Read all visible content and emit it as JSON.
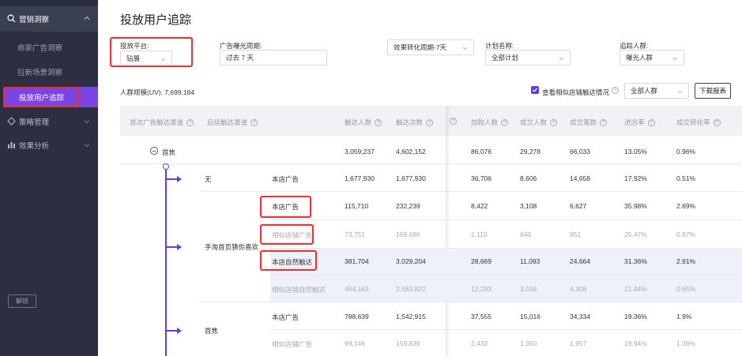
{
  "sidebar": {
    "top_item": "营销洞察",
    "sub_items": [
      "商家广告洞察",
      "拉新场景洞察"
    ],
    "active_item": "投放用户追踪",
    "groups": [
      "策略管理",
      "效果分析"
    ],
    "unlock": "解锁"
  },
  "page": {
    "title": "投放用户追踪"
  },
  "filters": {
    "platform": {
      "label": "投放平台:",
      "value": "钻展"
    },
    "period": {
      "label": "广告曝光周期:",
      "value": "过去 7 天"
    },
    "conversion": {
      "value": "效果转化周期-7天"
    },
    "plan": {
      "label": "计划名称:",
      "value": "全部计划"
    },
    "audience": {
      "label": "追踪人群:",
      "value": "曝光人群"
    }
  },
  "summary": {
    "uv": "人群规模(UV): 7,699,184",
    "similar_check_label": "查看相似店铺触达情况",
    "all_crowd": "全部人群",
    "download": "下载报表"
  },
  "table": {
    "headers": [
      "首次广告触达渠道",
      "后续触达渠道",
      "触达人数",
      "触达次数",
      "加购人数",
      "成交人数",
      "成交笔数",
      "进店率",
      "成交转化率"
    ],
    "help_mark": "?",
    "rows": [
      {
        "channel": "首焦",
        "sub": "",
        "source": "",
        "values": [
          "3,059,237",
          "4,602,152",
          "86,076",
          "29,278",
          "66,033",
          "13.05%",
          "0.96%"
        ]
      },
      {
        "channel": "",
        "sub": "无",
        "source": "本店广告",
        "values": [
          "1,677,930",
          "1,677,930",
          "36,706",
          "8,606",
          "14,658",
          "17.92%",
          "0.51%"
        ]
      },
      {
        "channel": "",
        "sub": "",
        "source": "本店广告",
        "values": [
          "115,710",
          "232,239",
          "8,422",
          "3,108",
          "6,627",
          "35.98%",
          "2.69%"
        ]
      },
      {
        "channel": "",
        "sub": "手淘首页猜你喜欢",
        "source": "相似店铺广告",
        "values": [
          "73,751",
          "109,686",
          "2,110",
          "640",
          "951",
          "25.47%",
          "0.87%"
        ]
      },
      {
        "channel": "",
        "sub": "",
        "source": "本店自然触达",
        "values": [
          "381,704",
          "3,029,204",
          "28,669",
          "11,093",
          "24,664",
          "31.36%",
          "2.91%"
        ]
      },
      {
        "channel": "",
        "sub": "",
        "source": "相似店铺自然触达",
        "values": [
          "464,163",
          "2,583,822",
          "12,293",
          "3,018",
          "4,308",
          "21.44%",
          "0.65%"
        ]
      },
      {
        "channel": "",
        "sub": "首焦",
        "source": "本店广告",
        "values": [
          "788,639",
          "1,542,915",
          "37,555",
          "15,016",
          "34,334",
          "19.36%",
          "1.9%"
        ]
      },
      {
        "channel": "",
        "sub": "",
        "source": "相似店铺广告",
        "values": [
          "99,146",
          "159,839",
          "2,432",
          "1,350",
          "1,957",
          "19.94%",
          "1.36%"
        ]
      }
    ]
  },
  "colors": {
    "accent": "#6a3ad8",
    "highlight": "#e83030",
    "sidebar": "#2b2f3f"
  }
}
